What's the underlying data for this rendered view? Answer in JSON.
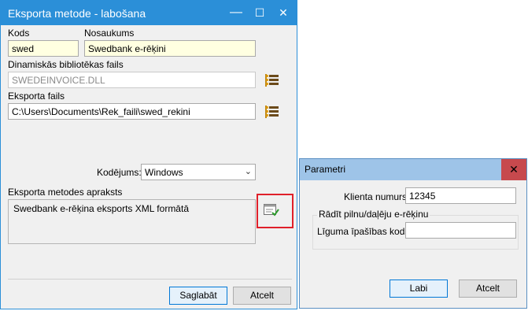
{
  "main_window": {
    "title": "Eksporta metode - labošana",
    "controls": {
      "minimize": "—",
      "maximize": "☐",
      "close": "✕"
    },
    "kods": {
      "label": "Kods",
      "value": "swed"
    },
    "nosaukums": {
      "label": "Nosaukums",
      "value": "Swedbank e-rēķini"
    },
    "dll": {
      "label": "Dinamiskās bibliotēkas fails",
      "value": "SWEDEINVOICE.DLL"
    },
    "export_file": {
      "label": "Eksporta fails",
      "value": "C:\\Users\\Documents\\Rek_faili\\swed_rekini"
    },
    "encoding": {
      "label": "Kodējums:",
      "value": "Windows"
    },
    "description": {
      "label": "Eksporta metodes apraksts",
      "value": "Swedbank e-rēķina eksports XML formātā"
    },
    "buttons": {
      "save": "Saglabāt",
      "cancel": "Atcelt"
    }
  },
  "param_window": {
    "title": "Parametri",
    "close": "✕",
    "client_number": {
      "label": "Klienta numurs:",
      "value": "12345"
    },
    "group_title": "Rādīt pilnu/daļēju e-rēķinu",
    "contract_code": {
      "label": "Līguma īpašības kods:",
      "value": ""
    },
    "buttons": {
      "ok": "Labi",
      "cancel": "Atcelt"
    }
  },
  "colors": {
    "titlebar": "#2b8fd8",
    "param_titlebar": "#9ec4e8",
    "close_red": "#c7494d",
    "highlight": "#e0202a",
    "required_field": "#ffffe1"
  },
  "icons": {
    "browse": "folder-list-icon",
    "params": "parameters-check-icon"
  }
}
